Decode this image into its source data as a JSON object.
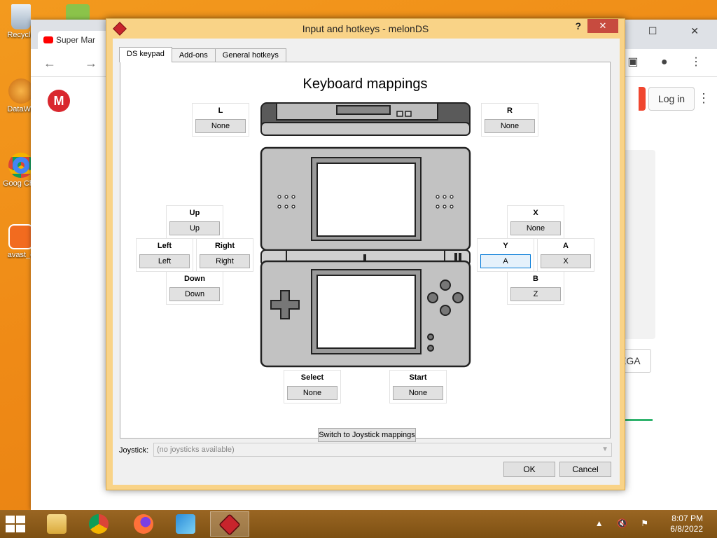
{
  "desktop": {
    "icons": [
      {
        "label": "Recycle"
      },
      {
        "label": "DataWa"
      },
      {
        "label": "Goog Chro"
      },
      {
        "label": "avast_o"
      }
    ]
  },
  "browser": {
    "tab_title": "Super Mar",
    "login_label": "Log in",
    "mega_logo": "M",
    "side_button": "EGA"
  },
  "dialog": {
    "title": "Input and hotkeys - melonDS",
    "help": "?",
    "close": "✕",
    "tabs": [
      "DS keypad",
      "Add-ons",
      "General hotkeys"
    ],
    "heading": "Keyboard mappings",
    "mappings": {
      "L": {
        "label": "L",
        "key": "None"
      },
      "R": {
        "label": "R",
        "key": "None"
      },
      "Up": {
        "label": "Up",
        "key": "Up"
      },
      "Left": {
        "label": "Left",
        "key": "Left"
      },
      "Right": {
        "label": "Right",
        "key": "Right"
      },
      "Down": {
        "label": "Down",
        "key": "Down"
      },
      "X": {
        "label": "X",
        "key": "None"
      },
      "Y": {
        "label": "Y",
        "key": "A"
      },
      "A": {
        "label": "A",
        "key": "X"
      },
      "B": {
        "label": "B",
        "key": "Z"
      },
      "Select": {
        "label": "Select",
        "key": "None"
      },
      "Start": {
        "label": "Start",
        "key": "None"
      }
    },
    "switch_label": "Switch to Joystick mappings",
    "joystick_label": "Joystick:",
    "joystick_value": "(no joysticks available)",
    "ok": "OK",
    "cancel": "Cancel"
  },
  "taskbar": {
    "time": "8:07 PM",
    "date": "6/8/2022"
  },
  "colors": {
    "desktop": "#ef8a16",
    "dialog_frame": "#f9d387",
    "close_button": "#c74b3f"
  }
}
